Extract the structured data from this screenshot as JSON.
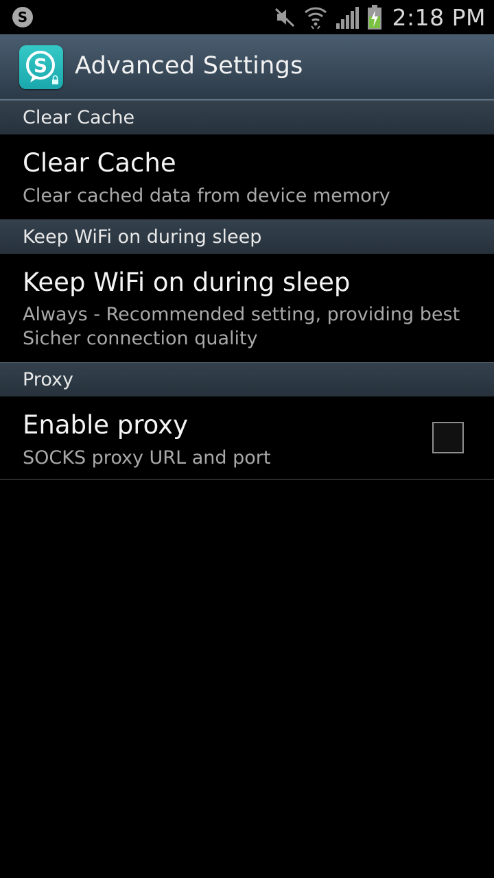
{
  "status_bar": {
    "time": "2:18 PM",
    "icons": [
      "skype-notification-icon",
      "mute-icon",
      "wifi-icon",
      "signal-icon",
      "battery-charging-icon"
    ]
  },
  "action_bar": {
    "title": "Advanced Settings",
    "icon": "skype-lock-app-icon",
    "icon_letter": "S"
  },
  "sections": [
    {
      "header": "Clear Cache",
      "title": "Clear Cache",
      "summary": "Clear cached data from device memory"
    },
    {
      "header": "Keep WiFi on during sleep",
      "title": "Keep WiFi on during sleep",
      "summary": "Always - Recommended setting, providing best Sicher connection quality"
    },
    {
      "header": "Proxy",
      "title": "Enable proxy",
      "summary": "SOCKS proxy URL and port",
      "checked": false
    }
  ],
  "colors": {
    "accent": "#2bbcbe",
    "battery": "#7bc142"
  }
}
